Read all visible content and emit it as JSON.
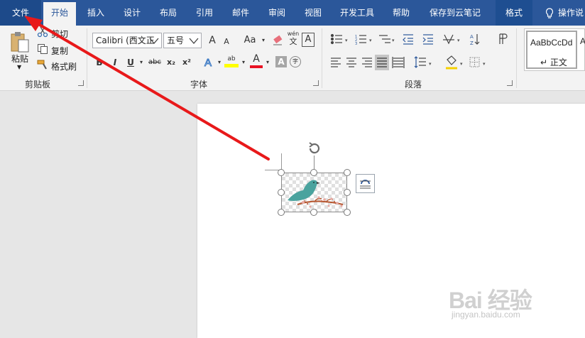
{
  "tabs": {
    "file": "文件",
    "home": "开始",
    "insert": "插入",
    "design": "设计",
    "layout": "布局",
    "references": "引用",
    "mailings": "邮件",
    "review": "审阅",
    "view": "视图",
    "developer": "开发工具",
    "help": "帮助",
    "save_cloud": "保存到云笔记",
    "format": "格式",
    "tell_me": "操作说"
  },
  "clipboard": {
    "paste": "粘贴",
    "cut": "剪切",
    "copy": "复制",
    "format_painter": "格式刷",
    "group_label": "剪贴板"
  },
  "font": {
    "font_name": "Calibri (西文正",
    "font_size": "五号",
    "grow": "A",
    "shrink": "A",
    "change_case": "Aa",
    "phonetic": "wén",
    "phonetic_sub": "文",
    "border_char": "A",
    "bold": "B",
    "italic": "I",
    "underline": "U",
    "strike": "abc",
    "subscript": "x₂",
    "superscript": "x²",
    "highlight": "ab",
    "font_color": "A",
    "shading": "A",
    "enclose": "字",
    "group_label": "字体"
  },
  "paragraph": {
    "group_label": "段落"
  },
  "styles": {
    "sample": "AaBbCcDd",
    "name": "正文",
    "sample2": "A"
  },
  "watermark": {
    "brand": "Bai 经验",
    "url": "jingyan.baidu.com"
  },
  "colors": {
    "tab_bar": "#2b579a",
    "ribbon": "#f3f3f3",
    "arrow": "#e8191a",
    "bird": "#4aa39e",
    "branch": "#b5562f",
    "highlight": "#ffff00",
    "font_color": "#e81123"
  }
}
